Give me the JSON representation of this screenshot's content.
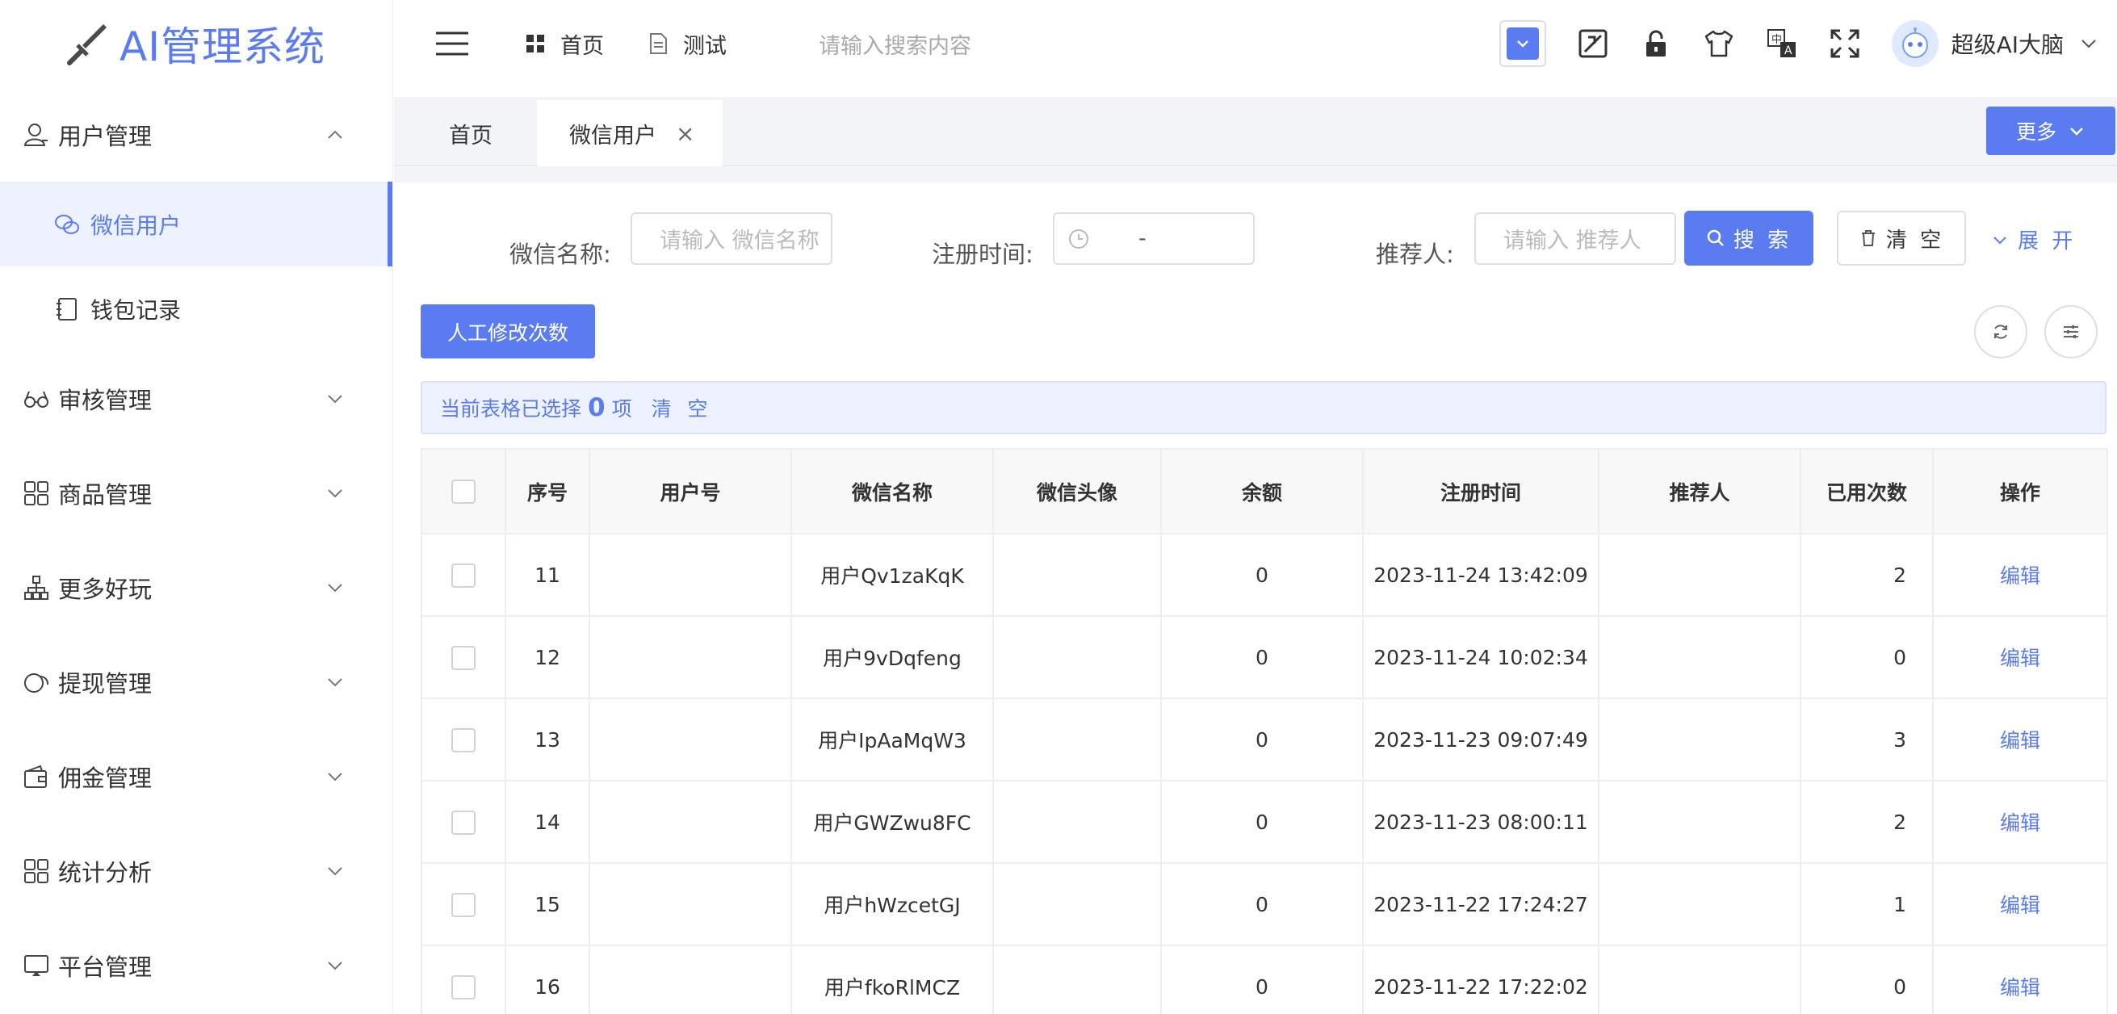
{
  "app": {
    "title": "AI管理系统"
  },
  "sidebar": {
    "items": [
      {
        "label": "用户管理",
        "icon": "user-icon",
        "expanded": true,
        "children": [
          {
            "label": "微信用户",
            "icon": "wechat-icon",
            "active": true
          },
          {
            "label": "钱包记录",
            "icon": "notebook-icon",
            "active": false
          }
        ]
      },
      {
        "label": "审核管理",
        "icon": "glasses-icon"
      },
      {
        "label": "商品管理",
        "icon": "grid-icon"
      },
      {
        "label": "更多好玩",
        "icon": "org-chart-icon"
      },
      {
        "label": "提现管理",
        "icon": "chat-bubble-icon"
      },
      {
        "label": "佣金管理",
        "icon": "wallet-icon"
      },
      {
        "label": "统计分析",
        "icon": "grid-icon"
      },
      {
        "label": "平台管理",
        "icon": "monitor-icon"
      }
    ]
  },
  "header": {
    "nav": [
      {
        "label": "首页",
        "icon": "grid-icon"
      },
      {
        "label": "测试",
        "icon": "document-icon"
      }
    ],
    "search_placeholder": "请输入搜索内容",
    "user_name": "超级AI大脑"
  },
  "tabs": {
    "items": [
      "首页",
      "微信用户"
    ],
    "active": "微信用户",
    "more_label": "更多"
  },
  "filter": {
    "wechat_name_label": "微信名称:",
    "wechat_name_placeholder": "请输入 微信名称",
    "register_time_label": "注册时间:",
    "register_time_separator": "-",
    "referrer_label": "推荐人:",
    "referrer_placeholder": "请输入 推荐人",
    "search_label": "搜 索",
    "clear_label": "清 空",
    "expand_label": "展 开"
  },
  "toolbar": {
    "manual_edit_label": "人工修改次数"
  },
  "selection": {
    "prefix": "当前表格已选择",
    "count": "0",
    "suffix": "项",
    "clear_label": "清 空"
  },
  "table": {
    "columns": [
      "序号",
      "用户号",
      "微信名称",
      "微信头像",
      "余额",
      "注册时间",
      "推荐人",
      "已用次数",
      "操作"
    ],
    "rows": [
      {
        "index": "11",
        "user_no": "",
        "name": "用户Qv1zaKqK",
        "avatar": "",
        "balance": "0",
        "reg_time": "2023-11-24 13:42:09",
        "referrer": "",
        "used": "2",
        "action": "编辑"
      },
      {
        "index": "12",
        "user_no": "",
        "name": "用户9vDqfeng",
        "avatar": "",
        "balance": "0",
        "reg_time": "2023-11-24 10:02:34",
        "referrer": "",
        "used": "0",
        "action": "编辑"
      },
      {
        "index": "13",
        "user_no": "",
        "name": "用户IpAaMqW3",
        "avatar": "",
        "balance": "0",
        "reg_time": "2023-11-23 09:07:49",
        "referrer": "",
        "used": "3",
        "action": "编辑"
      },
      {
        "index": "14",
        "user_no": "",
        "name": "用户GWZwu8FC",
        "avatar": "",
        "balance": "0",
        "reg_time": "2023-11-23 08:00:11",
        "referrer": "",
        "used": "2",
        "action": "编辑"
      },
      {
        "index": "15",
        "user_no": "",
        "name": "用户hWzcetGJ",
        "avatar": "",
        "balance": "0",
        "reg_time": "2023-11-22 17:24:27",
        "referrer": "",
        "used": "1",
        "action": "编辑"
      },
      {
        "index": "16",
        "user_no": "",
        "name": "用户fkoRlMCZ",
        "avatar": "",
        "balance": "0",
        "reg_time": "2023-11-22 17:22:02",
        "referrer": "",
        "used": "0",
        "action": "编辑"
      }
    ]
  },
  "colors": {
    "primary": "#5b7cf0",
    "active_bg": "#eef2fe"
  }
}
